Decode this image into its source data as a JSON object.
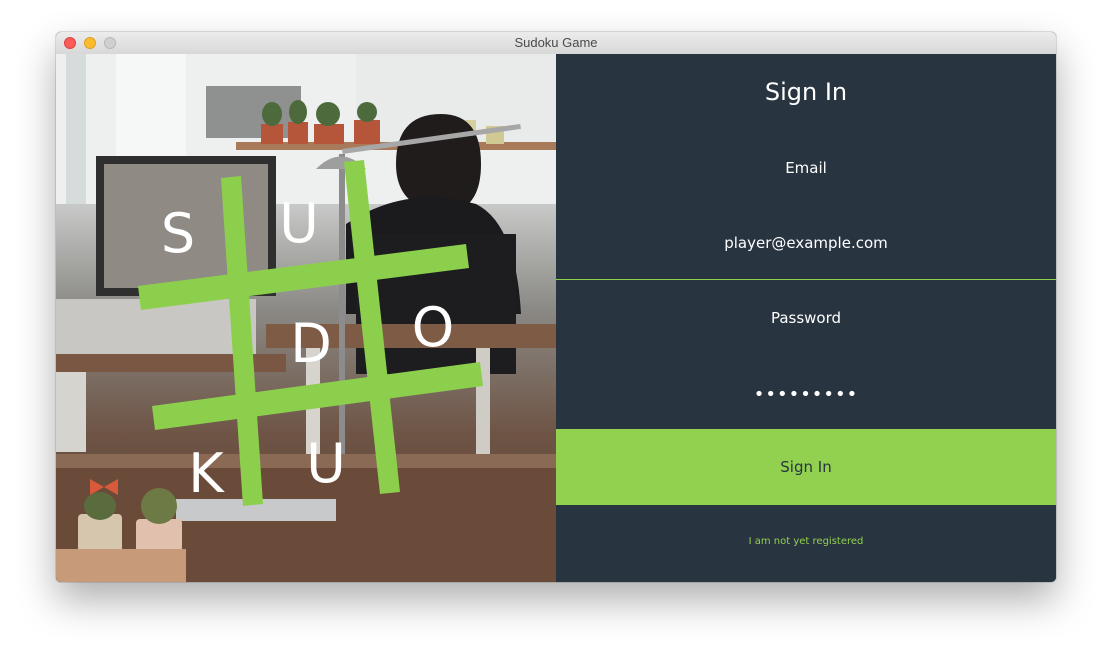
{
  "window": {
    "title": "Sudoku Game"
  },
  "logo": {
    "letters": [
      "S",
      "U",
      "D",
      "O",
      "K",
      "U"
    ],
    "accent_color": "#8ccf4d"
  },
  "form": {
    "heading": "Sign In",
    "email_label": "Email",
    "email_value": "player@example.com",
    "password_label": "Password",
    "password_value": "•••••••••",
    "submit_label": "Sign In",
    "register_link": "I am not yet registered"
  },
  "colors": {
    "panel_background": "#28343f",
    "accent": "#92d050",
    "text": "#ffffff"
  }
}
